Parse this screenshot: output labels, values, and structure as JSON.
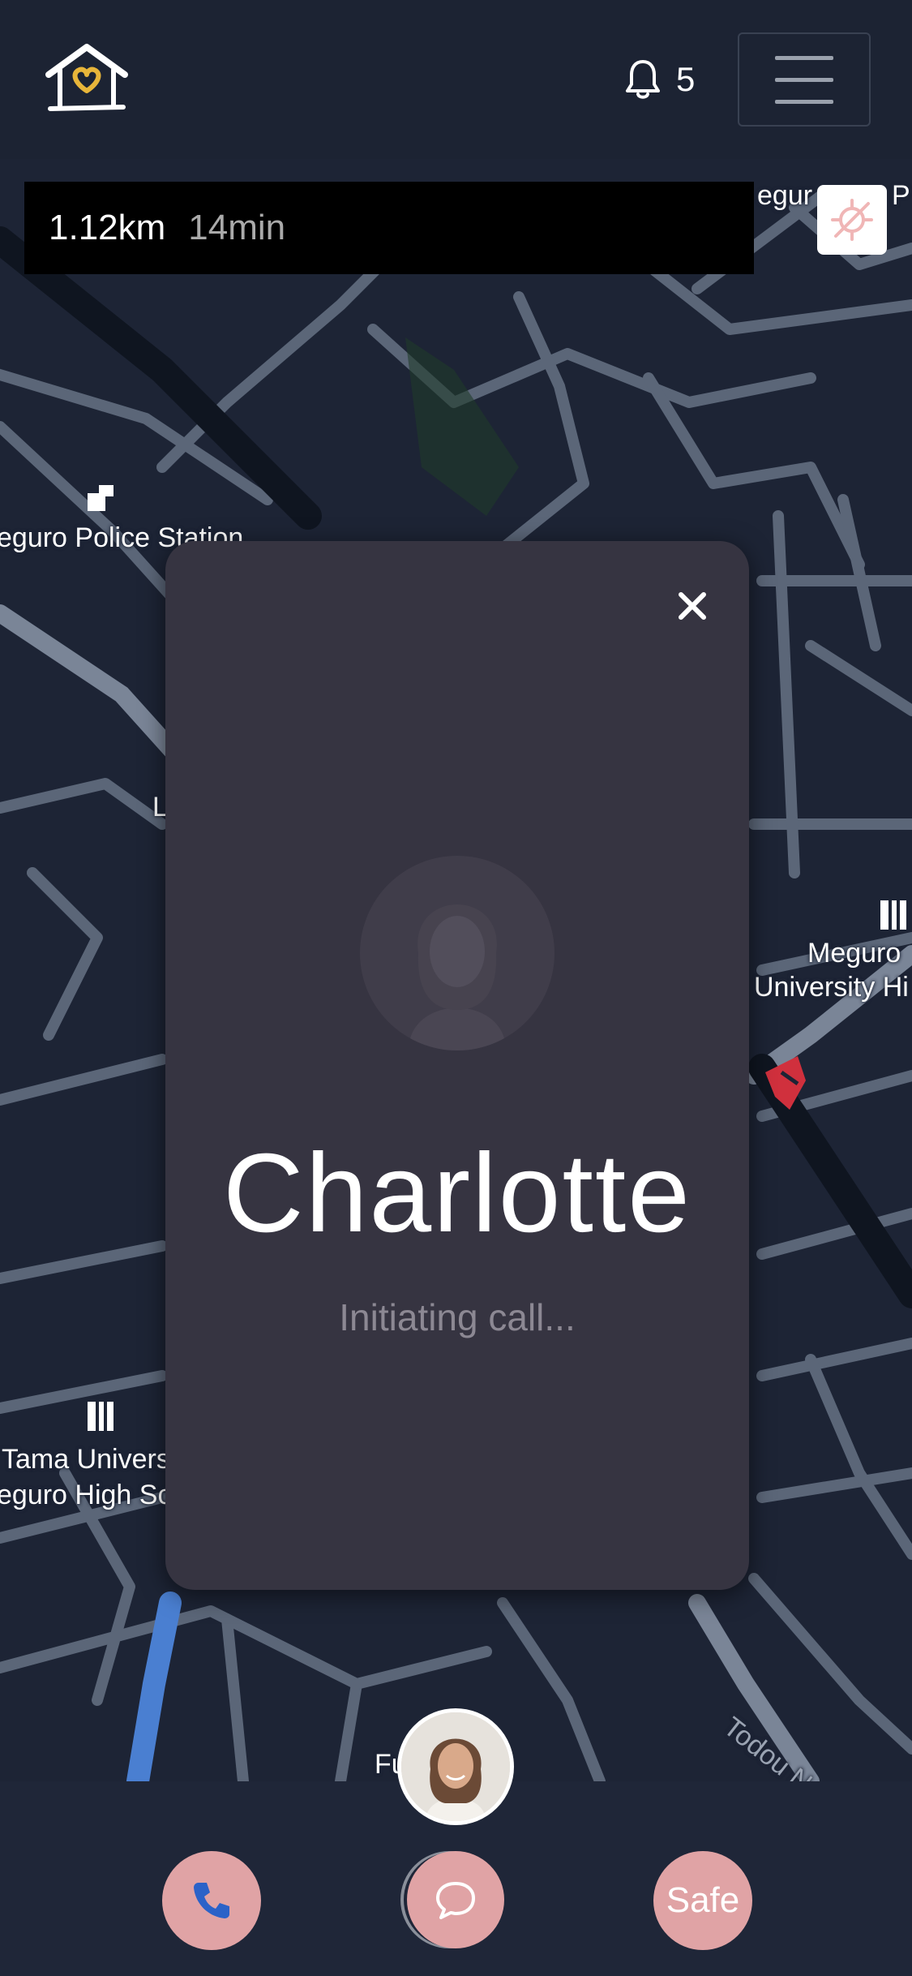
{
  "header": {
    "logo_icon": "house-heart-logo",
    "notification_icon": "bell-icon",
    "notification_count": "5",
    "menu_icon": "hamburger-menu-icon"
  },
  "route": {
    "distance": "1.12km",
    "duration": "14min",
    "recenter_icon": "location-off-icon"
  },
  "map": {
    "labels": {
      "police_station": "eguro Police Station",
      "meguro_university_1": "Meguro",
      "meguro_university_2": "University Hi",
      "tama_university_1": "Tama Univers",
      "tama_university_2": "eguro High Sc",
      "top_right": "egur",
      "top_right_2": "P",
      "todou": "Todou N",
      "fu": "Fu",
      "l": "L"
    }
  },
  "call_modal": {
    "caller_name": "Charlotte",
    "status": "Initiating call...",
    "close_icon": "close-icon"
  },
  "bottom": {
    "phone_icon": "phone-icon",
    "chat_icon": "chat-bubble-icon",
    "safe_label": "Safe"
  },
  "colors": {
    "background": "#1c2333",
    "modal": "#363441",
    "accent_button": "#e0a3a5",
    "route_line": "#4a7fd1",
    "poi_red": "#d0303d"
  }
}
